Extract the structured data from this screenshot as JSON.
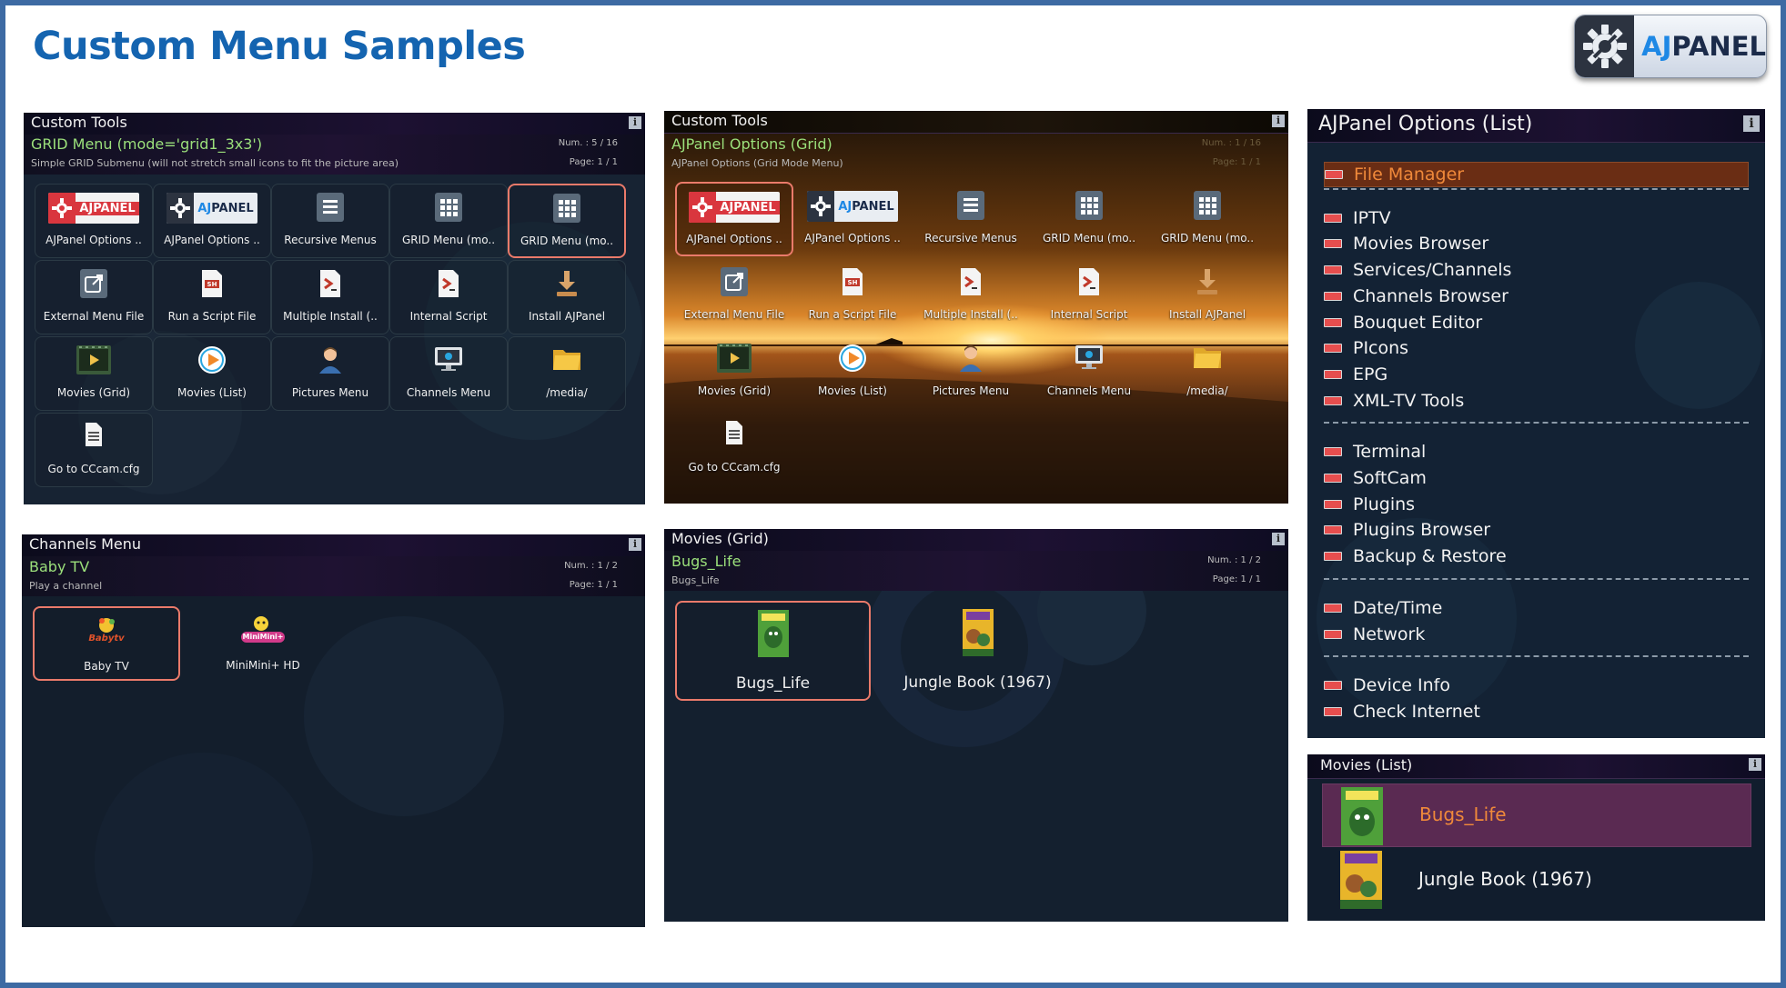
{
  "page": {
    "title": "Custom Menu Samples",
    "logo_text_a": "AJ",
    "logo_text_b": "PANEL",
    "accent": "#1464b0",
    "frame_color": "#3d6aa3"
  },
  "grid1": {
    "window_title": "Custom Tools",
    "subtitle": "GRID Menu (mode='grid1_3x3')",
    "description": "Simple GRID Submenu (will not stretch small icons to fit the picture area)",
    "num": "Num. : 5 / 16",
    "page": "Page: 1 / 1",
    "items": [
      {
        "label": "AJPanel Options ..",
        "icon": "ajpanel-red-logo-icon"
      },
      {
        "label": "AJPanel Options ..",
        "icon": "ajpanel-white-logo-icon"
      },
      {
        "label": "Recursive Menus",
        "icon": "menu-list-icon"
      },
      {
        "label": "GRID Menu (mo..",
        "icon": "grid-icon"
      },
      {
        "label": "GRID Menu (mo..",
        "icon": "grid-icon"
      },
      {
        "label": "External Menu File",
        "icon": "external-link-icon"
      },
      {
        "label": "Run a Script File",
        "icon": "sh-script-icon"
      },
      {
        "label": "Multiple Install (..",
        "icon": "terminal-file-icon"
      },
      {
        "label": "Internal Script",
        "icon": "terminal-file-icon"
      },
      {
        "label": "Install AJPanel",
        "icon": "download-icon"
      },
      {
        "label": "Movies (Grid)",
        "icon": "movie-icon"
      },
      {
        "label": "Movies (List)",
        "icon": "play-icon"
      },
      {
        "label": "Pictures Menu",
        "icon": "person-icon"
      },
      {
        "label": "Channels Menu",
        "icon": "monitor-icon"
      },
      {
        "label": "/media/",
        "icon": "folder-icon"
      },
      {
        "label": "Go to CCcam.cfg",
        "icon": "document-icon"
      }
    ]
  },
  "grid2": {
    "window_title": "Custom Tools",
    "subtitle": "AJPanel Options (Grid)",
    "description": "AJPanel Options (Grid Mode Menu)",
    "num": "Num. : 1 / 16",
    "page": "Page: 1 / 1",
    "items": [
      {
        "label": "AJPanel Options ..",
        "icon": "ajpanel-red-logo-icon"
      },
      {
        "label": "AJPanel Options ..",
        "icon": "ajpanel-white-logo-icon"
      },
      {
        "label": "Recursive Menus",
        "icon": "menu-list-icon"
      },
      {
        "label": "GRID Menu (mo..",
        "icon": "grid-icon"
      },
      {
        "label": "GRID Menu (mo..",
        "icon": "grid-icon"
      },
      {
        "label": "External Menu File",
        "icon": "external-link-icon"
      },
      {
        "label": "Run a Script File",
        "icon": "sh-script-icon"
      },
      {
        "label": "Multiple Install (..",
        "icon": "terminal-file-icon"
      },
      {
        "label": "Internal Script",
        "icon": "terminal-file-icon"
      },
      {
        "label": "Install AJPanel",
        "icon": "download-icon"
      },
      {
        "label": "Movies (Grid)",
        "icon": "movie-icon"
      },
      {
        "label": "Movies (List)",
        "icon": "play-icon"
      },
      {
        "label": "Pictures Menu",
        "icon": "person-icon"
      },
      {
        "label": "Channels Menu",
        "icon": "monitor-icon"
      },
      {
        "label": "/media/",
        "icon": "folder-icon"
      },
      {
        "label": "Go to CCcam.cfg",
        "icon": "document-icon"
      }
    ]
  },
  "options_list": {
    "window_title": "AJPanel Options (List)",
    "groups": [
      [
        "File Manager"
      ],
      [
        "IPTV",
        "Movies Browser",
        "Services/Channels",
        "Channels Browser",
        "Bouquet Editor",
        "PIcons",
        "EPG",
        "XML-TV Tools"
      ],
      [
        "Terminal",
        "SoftCam",
        "Plugins",
        "Plugins Browser",
        "Backup & Restore"
      ],
      [
        "Date/Time",
        "Network"
      ],
      [
        "Device Info",
        "Check Internet"
      ]
    ],
    "selected": "File Manager",
    "selected_color": "#f0893a"
  },
  "channels": {
    "window_title": "Channels Menu",
    "subtitle": "Baby TV",
    "description": "Play a channel",
    "num": "Num. : 1 / 2",
    "page": "Page: 1 / 1",
    "items": [
      {
        "label": "Baby TV",
        "icon": "babytv-logo-icon",
        "logo_text": "Babytv"
      },
      {
        "label": "MiniMini+ HD",
        "icon": "minimini-logo-icon",
        "logo_text": "MiniMini+"
      }
    ]
  },
  "movies_grid": {
    "window_title": "Movies (Grid)",
    "subtitle": "Bugs_Life",
    "description": "Bugs_Life",
    "num": "Num. : 1 / 2",
    "page": "Page: 1 / 1",
    "items": [
      {
        "label": "Bugs_Life",
        "icon": "bugs-life-poster-icon"
      },
      {
        "label": "Jungle Book (1967)",
        "icon": "jungle-book-poster-icon"
      }
    ]
  },
  "movies_list": {
    "window_title": "Movies (List)",
    "items": [
      {
        "label": "Bugs_Life",
        "icon": "bugs-life-poster-icon"
      },
      {
        "label": "Jungle Book (1967)",
        "icon": "jungle-book-poster-icon"
      }
    ],
    "selected_color": "#f0893a"
  }
}
